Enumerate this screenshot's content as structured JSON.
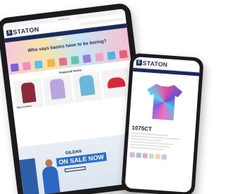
{
  "tablet": {
    "url": "SSTRUNET",
    "logo_text": "STATON",
    "nav_items": [
      "",
      "",
      "",
      "",
      "",
      ""
    ],
    "hero": {
      "badge": "",
      "title": "Who says basics have to be boring?",
      "shirt_colors": [
        "#7d5fd6",
        "#f08fb8",
        "#5ec0e8",
        "#f5b54a",
        "#e2738f",
        "#68c3a8",
        "#9b7de0",
        "#f3a1c4",
        "#52b3e0",
        "#e85d75"
      ]
    },
    "featured_title": "Featured Items",
    "products": [
      {
        "label": "BELLA+CANVAS",
        "color": "#8b2a3a"
      },
      {
        "label": "",
        "color": "#b6a6dc"
      },
      {
        "label": "",
        "color": "#6ab7d8"
      },
      {
        "label": "",
        "color": "#d8263c"
      }
    ],
    "banner": {
      "brand": "GILDAN",
      "sale_text": "ON SALE NOW",
      "side_number": "8400",
      "button": ""
    }
  },
  "phone": {
    "logo_text": "STATON",
    "account": "",
    "breadcrumb": "",
    "product_title": "",
    "image_caption": "",
    "sku": "1075CT",
    "swatch_colors": [
      "#d6b4e6",
      "#9fc3e8",
      "#e9a6c8",
      "#bfe2d1",
      "#f3d59e",
      "#c9c2ee"
    ]
  }
}
